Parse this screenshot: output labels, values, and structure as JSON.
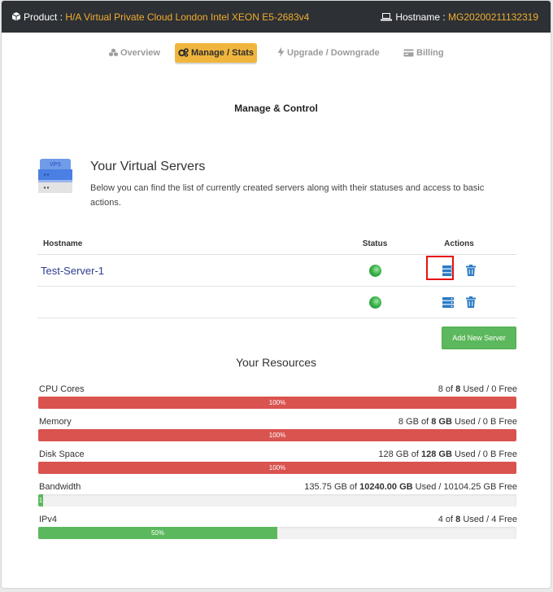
{
  "header": {
    "product_label": "Product : ",
    "product_value": "H/A Virtual Private Cloud London Intel XEON E5-2683v4",
    "hostname_label": "Hostname : ",
    "hostname_value": "MG20200211132319"
  },
  "tabs": [
    {
      "label": "Overview",
      "icon": "cubes-icon",
      "active": false
    },
    {
      "label": "Manage / Stats",
      "icon": "cogs-icon",
      "active": true
    },
    {
      "label": "Upgrade / Downgrade",
      "icon": "bolt-icon",
      "active": false
    },
    {
      "label": "Billing",
      "icon": "card-icon",
      "active": false
    }
  ],
  "section_title": "Manage & Control",
  "virtual_servers": {
    "icon_text": "VPS",
    "title": "Your Virtual Servers",
    "description": "Below you can find the list of currently created servers along with their statuses and access to basic actions."
  },
  "server_table": {
    "columns": [
      "Hostname",
      "Status",
      "Actions"
    ],
    "rows": [
      {
        "hostname": "Test-Server-1",
        "status": "online",
        "highlighted": true
      },
      {
        "hostname": "",
        "status": "online",
        "highlighted": false
      }
    ]
  },
  "add_server_label": "Add New Server",
  "resources": {
    "title": "Your Resources",
    "items": [
      {
        "label": "CPU Cores",
        "used": "8",
        "used_unit": "",
        "of": " of ",
        "total": "8",
        "suffix": " Used / 0 Free",
        "percent_label": "100%",
        "percent": 100,
        "color": "red"
      },
      {
        "label": "Memory",
        "used": "8 GB",
        "used_unit": "",
        "of": " of ",
        "total": "8 GB",
        "suffix": " Used / 0 B Free",
        "percent_label": "100%",
        "percent": 100,
        "color": "red"
      },
      {
        "label": "Disk Space",
        "used": "128 GB",
        "used_unit": "",
        "of": " of ",
        "total": "128 GB",
        "suffix": " Used / 0 B Free",
        "percent_label": "100%",
        "percent": 100,
        "color": "red"
      },
      {
        "label": "Bandwidth",
        "used": "135.75 GB",
        "used_unit": "",
        "of": " of ",
        "total": "10240.00 GB",
        "suffix": " Used / 10104.25 GB Free",
        "percent_label": "1",
        "percent": 1,
        "color": "green"
      },
      {
        "label": "IPv4",
        "used": "4",
        "used_unit": "",
        "of": " of ",
        "total": "8",
        "suffix": " Used / 4 Free",
        "percent_label": "50%",
        "percent": 50,
        "color": "green"
      }
    ]
  },
  "colors": {
    "topbar": "#2d3035",
    "accent": "#f0ad2e",
    "danger": "#d9534f",
    "success": "#5cb85c",
    "action_blue": "#2b7bc5",
    "highlight": "#e8110f"
  }
}
